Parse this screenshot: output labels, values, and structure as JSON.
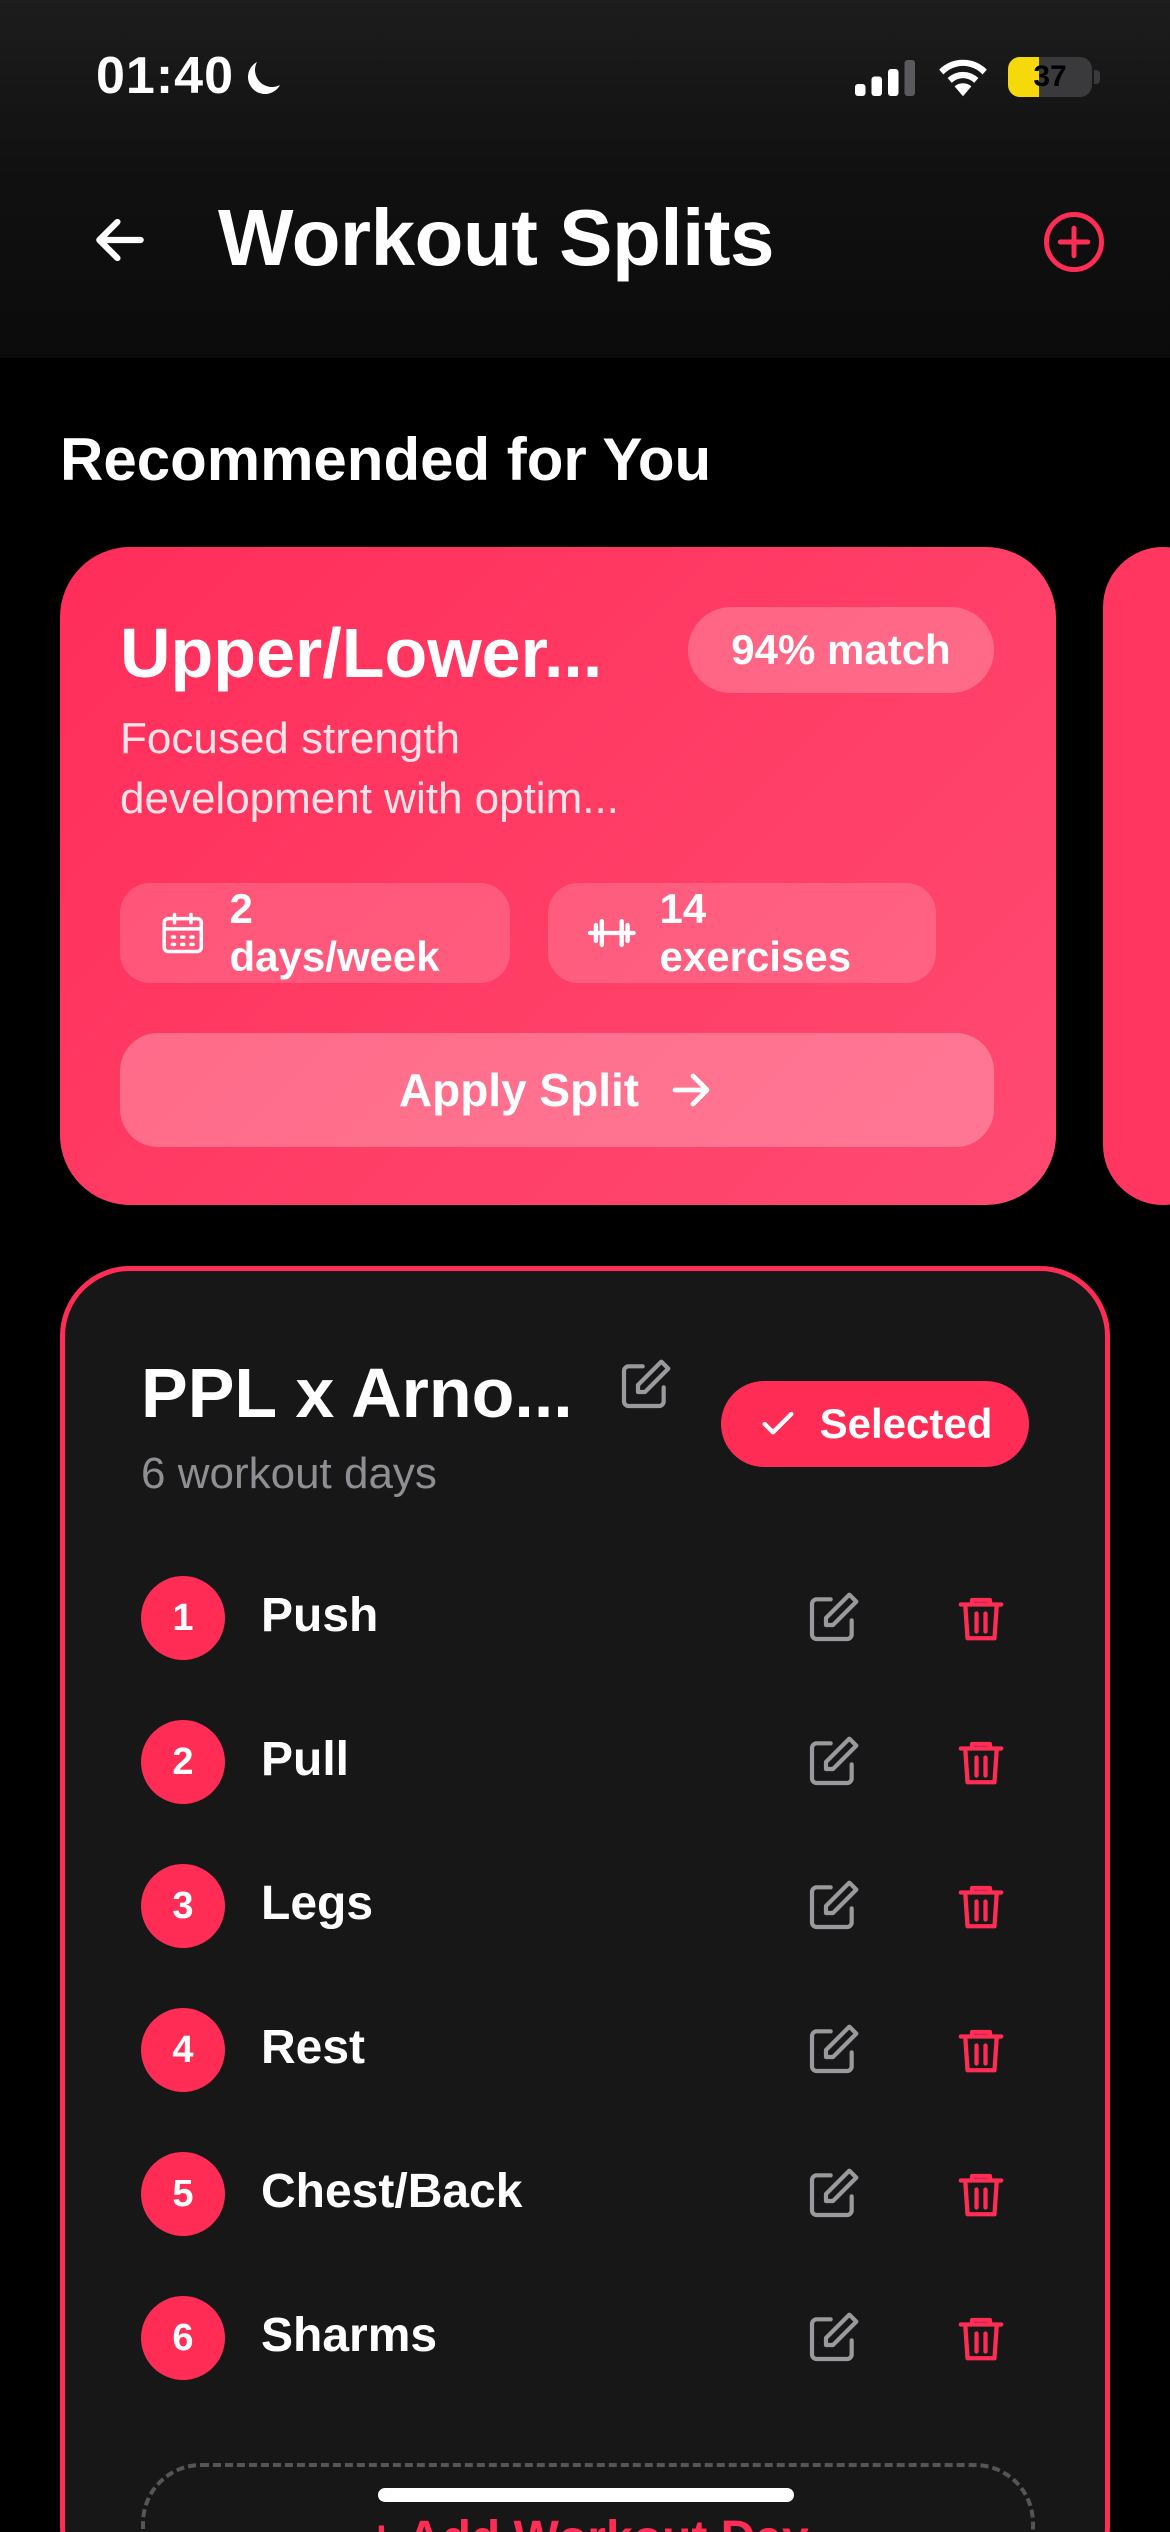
{
  "status_bar": {
    "time": "01:40",
    "battery": "37",
    "battery_level": 0.37,
    "icons": [
      "moon-icon",
      "signal-icon",
      "wifi-icon",
      "battery-icon"
    ]
  },
  "header": {
    "title": "Workout Splits",
    "back_icon": "arrow-left-icon",
    "add_icon": "plus-circle-icon"
  },
  "recommended": {
    "section_title": "Recommended for You",
    "card": {
      "title": "Upper/Lower...",
      "match": "94% match",
      "description": "Focused strength development with optim...",
      "days_chip": "2 days/week",
      "exercises_chip": "14 exercises",
      "apply_label": "Apply Split"
    }
  },
  "selected_split": {
    "name": "PPL x Arno...",
    "subtitle": "6 workout days",
    "badge": "Selected",
    "days": [
      {
        "number": "1",
        "name": "Push"
      },
      {
        "number": "2",
        "name": "Pull"
      },
      {
        "number": "3",
        "name": "Legs"
      },
      {
        "number": "4",
        "name": "Rest"
      },
      {
        "number": "5",
        "name": "Chest/Back"
      },
      {
        "number": "6",
        "name": "Sharms"
      }
    ],
    "add_day_label": "+ Add Workout Day"
  },
  "colors": {
    "accent": "#ff2d55",
    "card_bg": "#171717",
    "muted_text": "#8e8e93",
    "battery_fill": "#f5d90a"
  }
}
